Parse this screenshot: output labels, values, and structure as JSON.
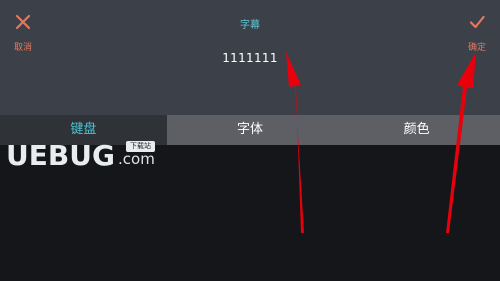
{
  "header": {
    "cancel_label": "取消",
    "title": "字幕",
    "confirm_label": "确定",
    "subtitle_value": "1111111"
  },
  "tabs": [
    {
      "label": "键盘",
      "active": true
    },
    {
      "label": "字体",
      "active": false
    },
    {
      "label": "颜色",
      "active": false
    }
  ],
  "watermark": {
    "main": "UEBUG",
    "domain_suffix": ".com",
    "badge": "下载站"
  },
  "colors": {
    "header_bg": "#3b4049",
    "accent_cyan": "#4cc3d6",
    "action_orange": "#e8775c",
    "annotation_red": "#e8000c"
  }
}
